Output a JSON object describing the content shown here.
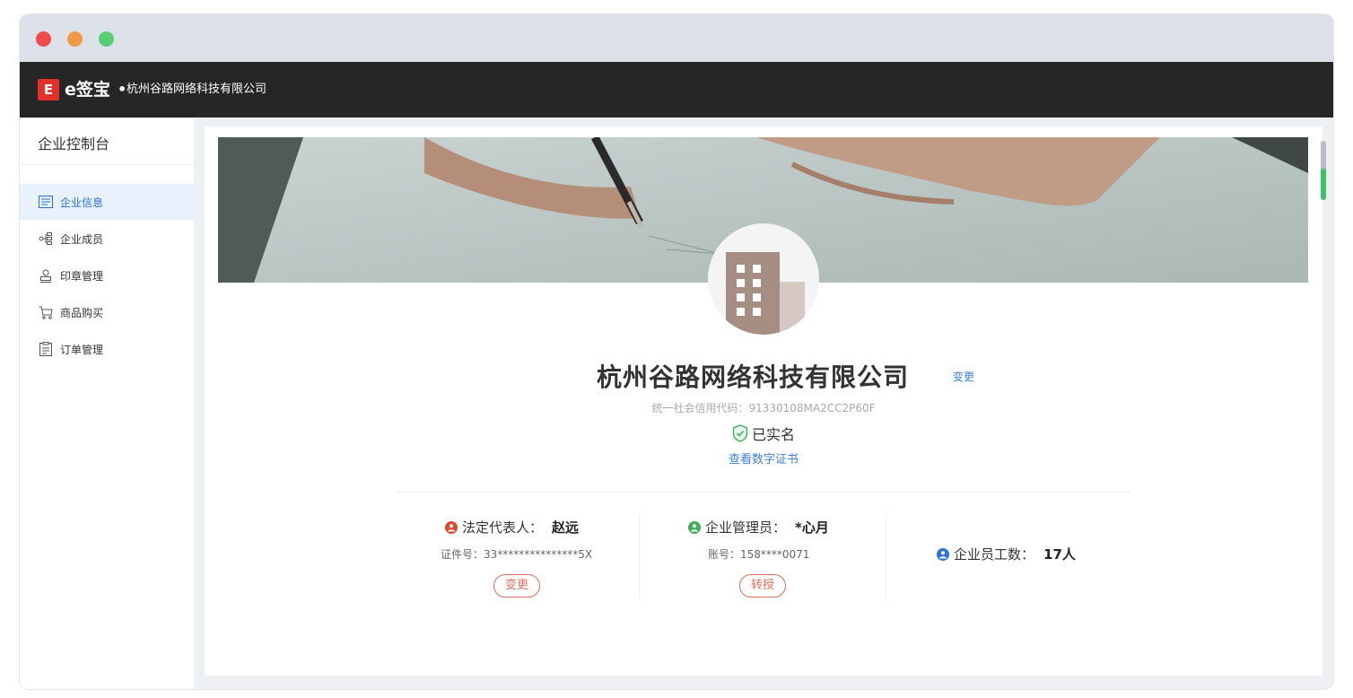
{
  "window": {
    "traffic_lights": [
      "close",
      "minimize",
      "maximize"
    ]
  },
  "topbar": {
    "logo_icon": "esign-logo-icon",
    "brand": "e签宝",
    "separator": "•",
    "company": "杭州谷路网络科技有限公司"
  },
  "sidebar": {
    "title": "企业控制台",
    "items": [
      {
        "label": "企业信息",
        "icon": "info-list-icon",
        "active": true
      },
      {
        "label": "企业成员",
        "icon": "org-tree-icon",
        "active": false
      },
      {
        "label": "印章管理",
        "icon": "seal-icon",
        "active": false
      },
      {
        "label": "商品购买",
        "icon": "cart-icon",
        "active": false
      },
      {
        "label": "订单管理",
        "icon": "order-doc-icon",
        "active": false
      }
    ]
  },
  "main": {
    "company_name": "杭州谷路网络科技有限公司",
    "change_label": "变更",
    "credit_code": "统一社会信用代码：91330108MA2CC2P60F",
    "verified_label": "已实名",
    "cert_link": "查看数字证书",
    "legal_rep": {
      "label": "法定代表人：",
      "value": "赵远",
      "id_text": "证件号：33***************5X",
      "button": "变更",
      "color": "#e0482f"
    },
    "admin": {
      "label": "企业管理员：",
      "value": "*心月",
      "account_text": "账号：158****0071",
      "button": "转授",
      "color": "#3fae5a"
    },
    "employees": {
      "label": "企业员工数：",
      "value": "17人",
      "color": "#2f74d6"
    }
  },
  "colors": {
    "accent_blue": "#3d7fe0",
    "danger_red": "#e06b5e",
    "topbar_bg": "#262626",
    "active_menu_bg": "#e8f1fc"
  }
}
